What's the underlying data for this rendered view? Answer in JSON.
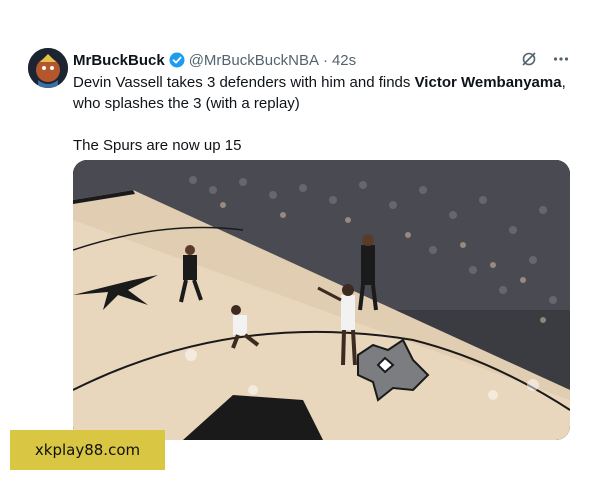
{
  "tweet": {
    "display_name": "MrBuckBuck",
    "handle": "@MrBuckBuckNBA",
    "separator": "·",
    "time": "42s",
    "text_part1": "Devin Vassell takes 3 defenders with him and finds ",
    "text_bold": "Victor Wembanyama",
    "text_part2": ",",
    "text_line2": "who splashes the 3 (with a replay)",
    "text_para2": "The Spurs are now up 15"
  },
  "icons": {
    "verified": "verified-badge-icon",
    "grok": "grok-icon",
    "more": "more-options-icon"
  },
  "colors": {
    "verified_blue": "#1d9bf0",
    "secondary_text": "#536471",
    "watermark_bg": "#d9c642"
  },
  "watermark": {
    "text": "xkplay88.com"
  }
}
